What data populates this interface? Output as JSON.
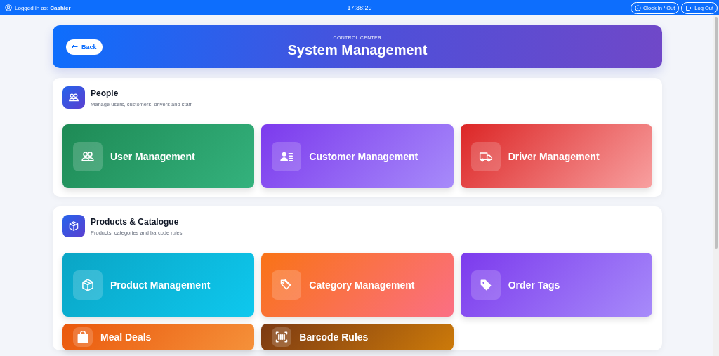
{
  "top_bar": {
    "login_label": "Logged in as:",
    "user": "Cashier",
    "clock": "17:38:29",
    "buttons": [
      {
        "label": "Clock In / Out",
        "kind": "clock"
      },
      {
        "label": "Log Out",
        "kind": "logout"
      }
    ]
  },
  "header": {
    "back": "Back",
    "eyebrow": "CONTROL CENTER",
    "title": "System Management"
  },
  "sections": [
    {
      "title": "People",
      "subtitle": "Manage users, customers, drivers and staff",
      "kind": "users",
      "tiles": [
        {
          "label": "User Management",
          "kind": "users",
          "color": "#1e8a55"
        },
        {
          "label": "Customer Management",
          "kind": "contact",
          "color": "#7c3aed"
        },
        {
          "label": "Driver Management",
          "kind": "truck",
          "color": "#dc2626"
        }
      ]
    },
    {
      "title": "Products & Catalogue",
      "subtitle": "Products, categories and barcode rules",
      "kind": "box",
      "tiles": [
        {
          "label": "Product Management",
          "kind": "box",
          "color": "#0aa5c5"
        },
        {
          "label": "Category Management",
          "kind": "tags",
          "color": "#f97316"
        },
        {
          "label": "Order Tags",
          "kind": "tag",
          "color": "#7c3aed"
        },
        {
          "label": "Meal Deals",
          "kind": "bag",
          "color": "#ea580c"
        },
        {
          "label": "Barcode Rules",
          "kind": "barcode",
          "color": "#7c3a12"
        }
      ]
    }
  ]
}
